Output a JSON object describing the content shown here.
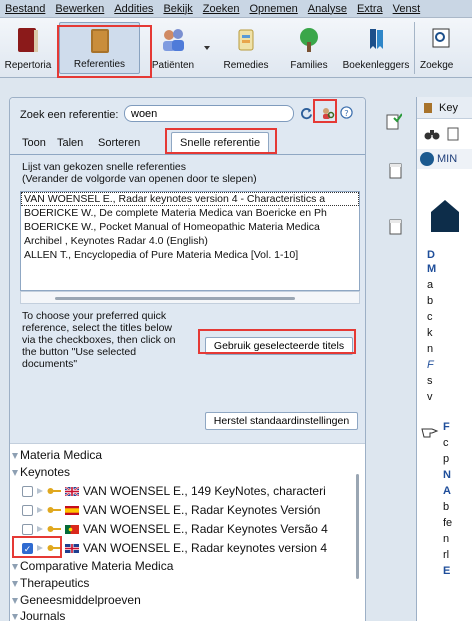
{
  "menu": [
    "Bestand",
    "Bewerken",
    "Addities",
    "Bekijk",
    "Zoeken",
    "Opnemen",
    "Analyse",
    "Extra",
    "Venst"
  ],
  "toolbar": {
    "repertory": "Repertoria",
    "references": "Referenties",
    "patients": "Patiënten",
    "remedies": "Remedies",
    "families": "Families",
    "bookmarks": "Boekenleggers",
    "search": "Zoekge"
  },
  "search": {
    "label": "Zoek een referentie:",
    "value": "woen"
  },
  "tabs": [
    "Toon",
    "Talen",
    "Sorteren",
    "Snelle referentie"
  ],
  "quick": {
    "desc_line1": "Lijst van gekozen snelle referenties",
    "desc_line2": "(Verander de volgorde van openen door te slepen)",
    "docs": [
      "VAN WOENSEL E., Radar keynotes version 4 - Characteristics a",
      "BOERICKE W., De complete Materia Medica van Boericke en Ph",
      "BOERICKE W., Pocket Manual of Homeopathic Materia Medica",
      "Archibel , Keynotes Radar 4.0 (English)",
      "ALLEN T., Encyclopedia of Pure Materia Medica [Vol. 1-10]"
    ],
    "help_lines": [
      "To choose your preferred quick",
      "reference, select the titles below",
      "via the checkboxes, then click on",
      "the button \"Use selected",
      "documents\""
    ],
    "use_selected": "Gebruik geselecteerde titels",
    "reset": "Herstel standaardinstellingen"
  },
  "tree": {
    "materia": "Materia Medica",
    "keynotes": "Keynotes",
    "items": [
      {
        "text": "VAN WOENSEL E., 149 KeyNotes, characteri",
        "checked": false,
        "flag": "uk"
      },
      {
        "text": "VAN WOENSEL E., Radar Keynotes Versión",
        "checked": false,
        "flag": "es"
      },
      {
        "text": "VAN WOENSEL E., Radar Keynotes Versão 4",
        "checked": false,
        "flag": "pt"
      },
      {
        "text": "VAN WOENSEL E., Radar keynotes version 4",
        "checked": true,
        "flag": "uk"
      }
    ],
    "others": [
      "Comparative Materia Medica",
      "Therapeutics",
      "Geneesmiddelproeven",
      "Journals"
    ]
  },
  "right": {
    "tab": "Key",
    "min": "MIN",
    "lines": [
      "D",
      "M",
      "a",
      "b",
      "c",
      "k",
      "n",
      "F",
      "s",
      "v",
      "F",
      "c",
      "p",
      "N",
      "A",
      "b",
      "fe",
      "n",
      "rl",
      "E"
    ]
  },
  "colors": {
    "highlight": "#e53935",
    "accent": "#2f6bd1",
    "link_blue": "#1f4e9a"
  }
}
